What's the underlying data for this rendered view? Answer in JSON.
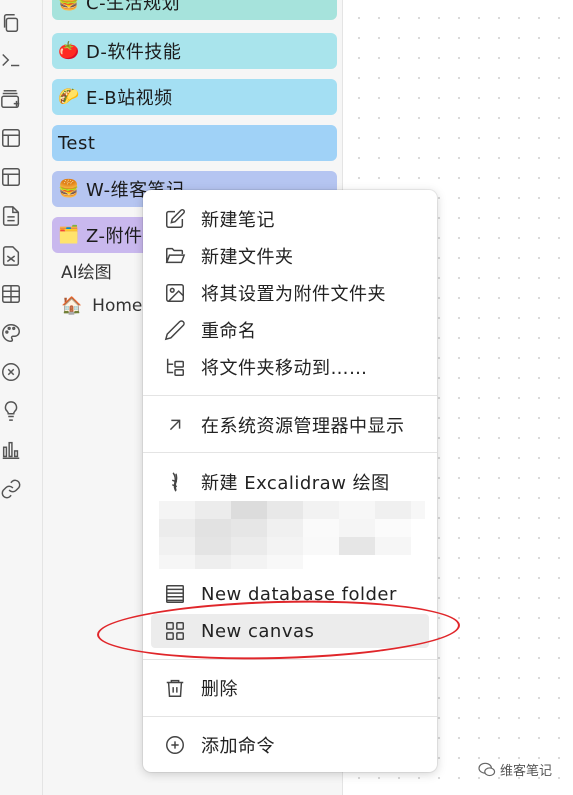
{
  "ribbon": {
    "icons": [
      "copy-icon",
      "terminal-icon",
      "card-add-icon",
      "layout-icon",
      "layout-alt-icon",
      "file-text-icon",
      "file-diff-icon",
      "table-icon",
      "palette-icon",
      "circle-x-icon",
      "lightbulb-icon",
      "bar-chart-icon",
      "link-icon"
    ]
  },
  "explorer": {
    "folders": [
      {
        "emoji": "🍔",
        "label": "C-生活规划",
        "color": "#a6e3dc"
      },
      {
        "emoji": "🍅",
        "label": "D-软件技能",
        "color": "#a9e4ec"
      },
      {
        "emoji": "🌮",
        "label": "E-B站视频",
        "color": "#a4dff3"
      },
      {
        "emoji": "",
        "label": "Test",
        "color": "#a0d2f7"
      },
      {
        "emoji": "🍔",
        "label": "W-维客笔记",
        "color": "#b5c5f1"
      },
      {
        "emoji": "🗂️",
        "label": "Z-附件",
        "color": "#c9b8ee"
      }
    ],
    "items": [
      {
        "emoji": "",
        "label": "AI绘图"
      },
      {
        "emoji": "🏠",
        "label": "Home"
      }
    ]
  },
  "context_menu": {
    "items": [
      {
        "icon": "edit-icon",
        "label": "新建笔记"
      },
      {
        "icon": "folder-open-icon",
        "label": "新建文件夹"
      },
      {
        "icon": "image-icon",
        "label": "将其设置为附件文件夹"
      },
      {
        "icon": "pencil-icon",
        "label": "重命名"
      },
      {
        "icon": "folder-tree-icon",
        "label": "将文件夹移动到……"
      },
      {
        "icon": "arrow-up-right-icon",
        "label": "在系统资源管理器中显示"
      },
      {
        "icon": "excalidraw-icon",
        "label": "新建 Excalidraw 绘图"
      },
      {
        "icon": "database-icon",
        "label": "New database folder"
      },
      {
        "icon": "layout-grid-icon",
        "label": "New canvas"
      },
      {
        "icon": "trash-icon",
        "label": "删除"
      },
      {
        "icon": "plus-circle-icon",
        "label": "添加命令"
      }
    ],
    "highlighted_item": "New canvas"
  },
  "annotation": {
    "color": "#e0262a"
  },
  "watermark": {
    "label": "维客笔记"
  }
}
